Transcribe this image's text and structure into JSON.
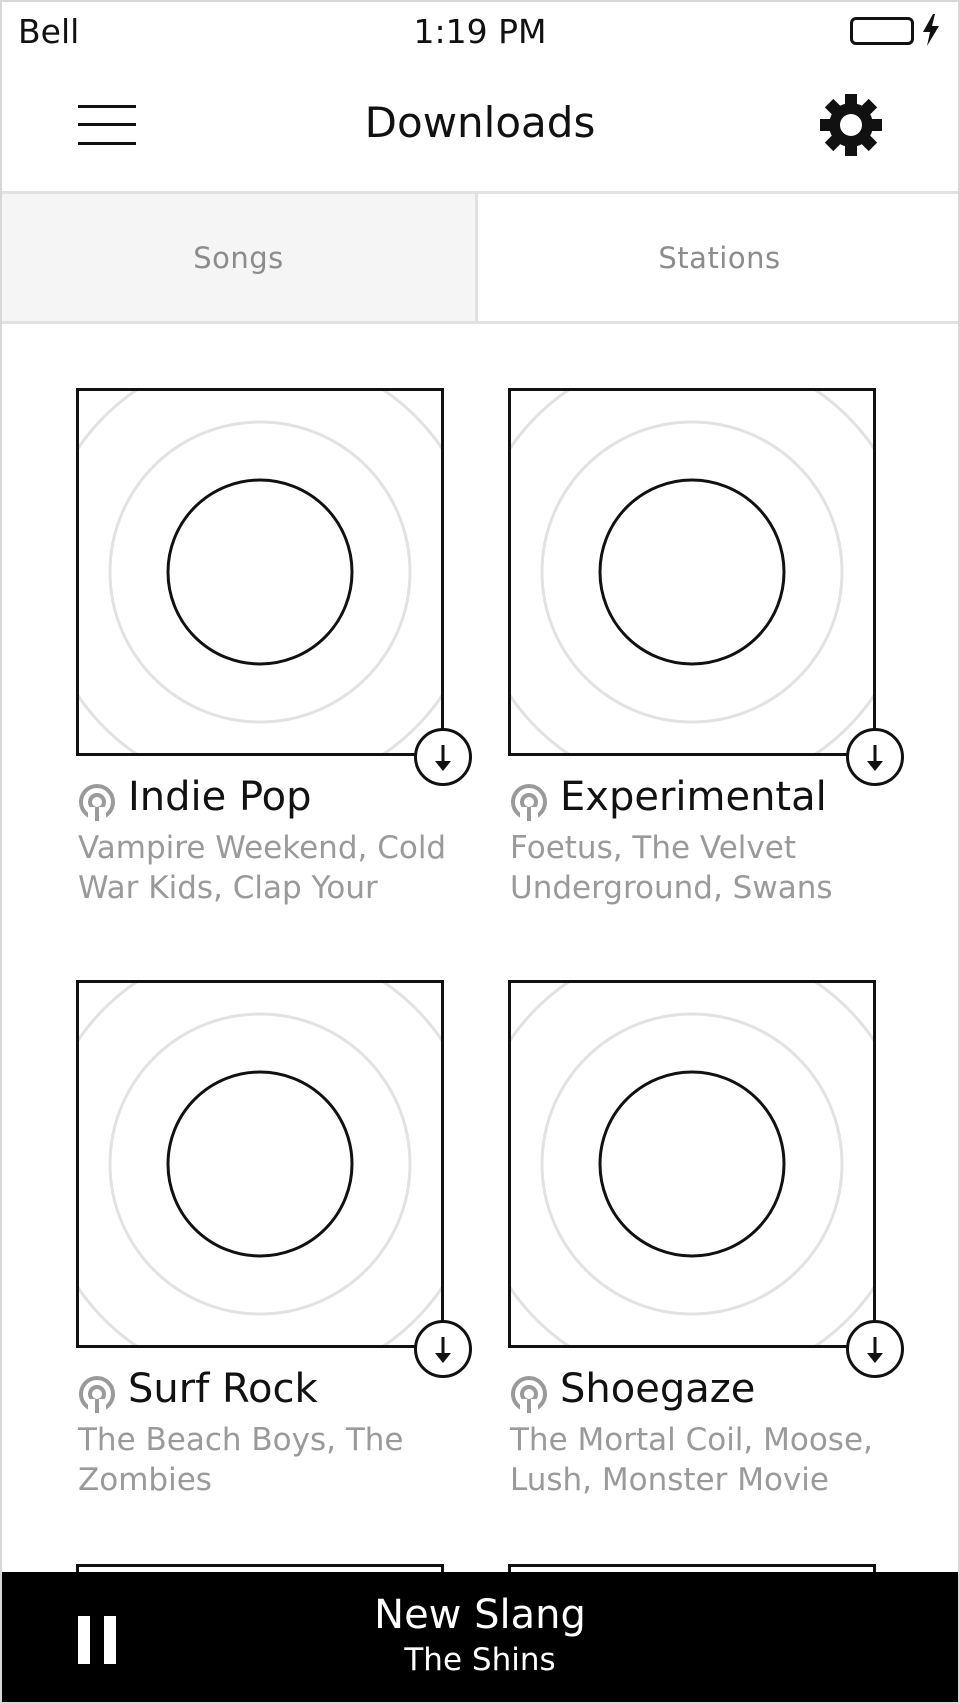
{
  "status": {
    "carrier": "Bell",
    "time": "1:19 PM"
  },
  "header": {
    "title": "Downloads"
  },
  "tabs": [
    {
      "label": "Songs",
      "selected": true
    },
    {
      "label": "Stations",
      "selected": false
    }
  ],
  "stations": [
    {
      "title": "Indie Pop",
      "subtitle": "Vampire Weekend, Cold War Kids, Clap Your"
    },
    {
      "title": "Experimental",
      "subtitle": "Foetus, The Velvet Underground, Swans"
    },
    {
      "title": "Surf Rock",
      "subtitle": "The Beach Boys, The Zombies"
    },
    {
      "title": "Shoegaze",
      "subtitle": "The Mortal Coil, Moose, Lush, Monster Movie"
    }
  ],
  "now_playing": {
    "title": "New Slang",
    "artist": "The Shins"
  },
  "icons": {
    "menu": "hamburger-menu-icon",
    "settings": "gear-icon",
    "station": "station-broadcast-icon",
    "download": "download-icon",
    "pause": "pause-icon",
    "battery": "battery-icon",
    "charging": "lightning-bolt-icon"
  },
  "colors": {
    "accent": "#000000",
    "muted_text": "#9a9a9a",
    "tab_selected_bg": "#f5f5f5"
  }
}
